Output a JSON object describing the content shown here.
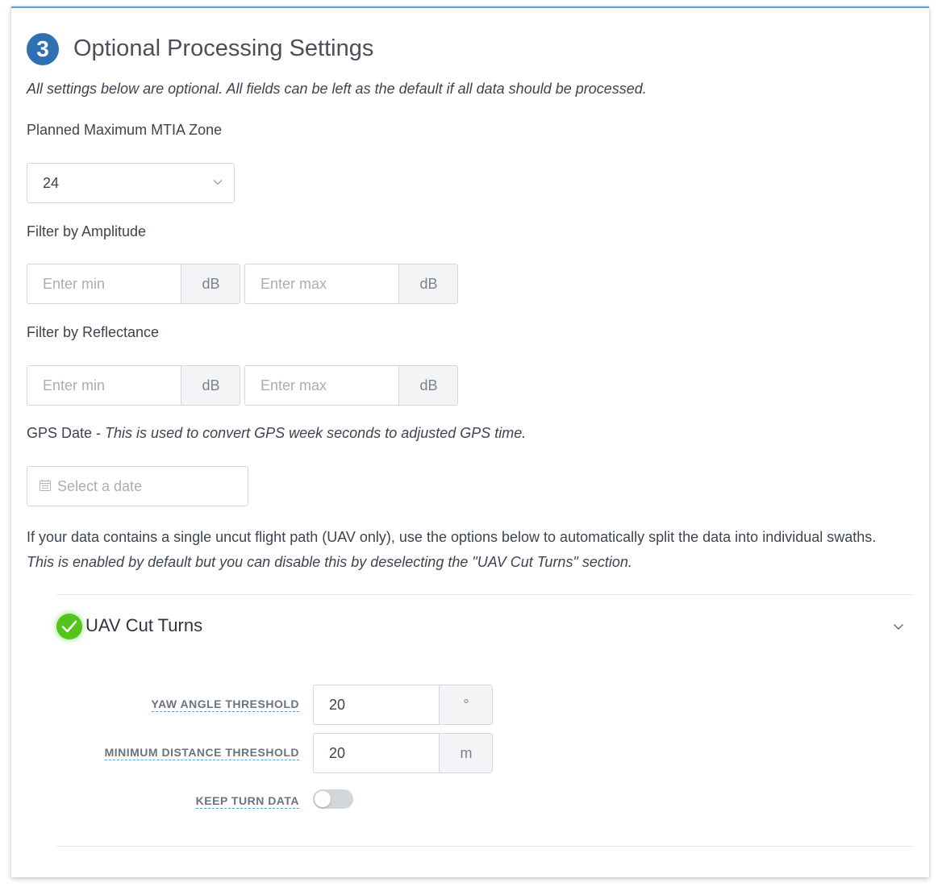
{
  "section": {
    "step_number": "3",
    "title": "Optional Processing Settings",
    "intro": "All settings below are optional. All fields can be left as the default if all data should be processed."
  },
  "mtia": {
    "label": "Planned Maximum MTIA Zone",
    "selected_value": "24"
  },
  "amplitude": {
    "label": "Filter by Amplitude",
    "min_placeholder": "Enter min",
    "min_unit": "dB",
    "max_placeholder": "Enter max",
    "max_unit": "dB"
  },
  "reflectance": {
    "label": "Filter by Reflectance",
    "min_placeholder": "Enter min",
    "min_unit": "dB",
    "max_placeholder": "Enter max",
    "max_unit": "dB"
  },
  "gps_date": {
    "label": "GPS Date",
    "separator": " - ",
    "note": "This is used to convert GPS week seconds to adjusted GPS time.",
    "placeholder": "Select a date"
  },
  "uav_info": {
    "text": "If your data contains a single uncut flight path (UAV only), use the options below to automatically split the data into individual swaths.",
    "note": "This is enabled by default but you can disable this by deselecting the \"UAV Cut Turns\" section."
  },
  "uav_cut_turns": {
    "title": "UAV Cut Turns",
    "enabled": true,
    "expanded": true,
    "yaw_label": "YAW ANGLE THRESHOLD",
    "yaw_value": "20",
    "yaw_unit": "°",
    "min_dist_label": "MINIMUM DISTANCE THRESHOLD",
    "min_dist_value": "20",
    "min_dist_unit": "m",
    "keep_turn_label": "KEEP TURN DATA",
    "keep_turn_on": false
  },
  "colors": {
    "accent": "#2f6fb3",
    "success": "#52c41a",
    "top_border": "#5aa2e0"
  },
  "icons": {
    "select_chevron": "chevron-down-icon",
    "calendar": "calendar-icon",
    "check": "check-circle-icon",
    "collapse_chevron": "chevron-down-icon"
  }
}
